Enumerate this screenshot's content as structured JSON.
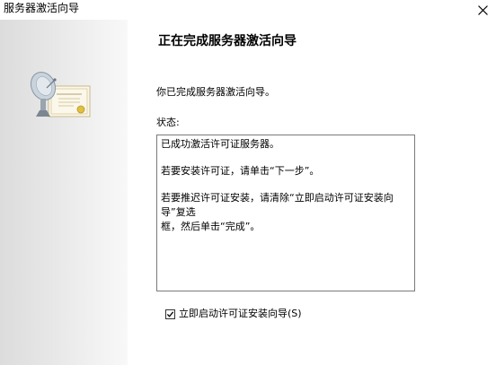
{
  "window": {
    "title": "服务器激活向导",
    "close_icon": "close-icon"
  },
  "sidebar": {
    "art_icon": "satellite-certificate-icon"
  },
  "main": {
    "heading": "正在完成服务器激活向导",
    "intro": "你已完成服务器激活向导。",
    "status_label": "状态:",
    "status_lines": [
      "已成功激活许可证服务器。",
      "若要安装许可证，请单击“下一步”。",
      "若要推迟许可证安装，请清除“立即启动许可证安装向导”复选",
      "框，然后单击“完成”。"
    ],
    "checkbox": {
      "label": "立即启动许可证安装向导(S)",
      "checked": true
    }
  },
  "colors": {
    "sidebar_gradient_start": "#dcdcdc",
    "sidebar_gradient_end": "#f8f8f8",
    "border": "#7a7a7a"
  }
}
